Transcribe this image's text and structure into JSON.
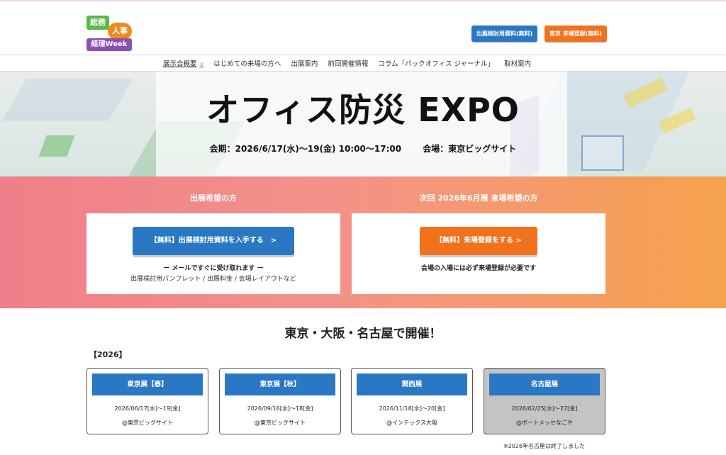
{
  "header": {
    "logo": {
      "line1": "総務",
      "line2": "人事",
      "line3": "経理Week"
    },
    "buttons": {
      "exhibit_docs": "出展検討用資料(無料)",
      "visitor_register": "東京 来場登録(無料)"
    }
  },
  "nav": {
    "items": [
      "展示会概要",
      "はじめての来場の方へ",
      "出展案内",
      "前回開催情報",
      "コラム「バックオフィス ジャーナル」",
      "取材案内"
    ]
  },
  "hero": {
    "title": "オフィス防災 EXPO",
    "period": "会期：2026/6/17(水)～19(金) 10:00～17:00",
    "venue": "会場：東京ビッグサイト"
  },
  "cta": {
    "exhibitor": {
      "heading": "出展希望の方",
      "button": "【無料】出展検討用資料を入手する　>",
      "note1": "ー メールですぐに受け取れます ー",
      "note2": "出展検討用パンフレット / 出展料金 / 会場レイアウトなど"
    },
    "visitor": {
      "heading": "次回 2026年6月展  来場希望の方",
      "button": "【無料】来場登録をする >",
      "note1": "会場の入場には必ず来場登録が必要です"
    }
  },
  "venues": {
    "title": "東京・大阪・名古屋で開催！",
    "year": "【2026】",
    "cards": [
      {
        "name": "東京展【春】",
        "date": "2026/06/17[水]～19[金]",
        "place": "@東京ビッグサイト"
      },
      {
        "name": "東京展【秋】",
        "date": "2026/09/16[水]～18[金]",
        "place": "@東京ビッグサイト"
      },
      {
        "name": "関西展",
        "date": "2026/11/18[水]～20[金]",
        "place": "@インテックス大阪"
      },
      {
        "name": "名古屋展",
        "date": "2026/02/25[水]～27[金]",
        "place": "@ポートメッセなごや"
      }
    ],
    "footnote": "※2026年名古屋は終了しました"
  }
}
